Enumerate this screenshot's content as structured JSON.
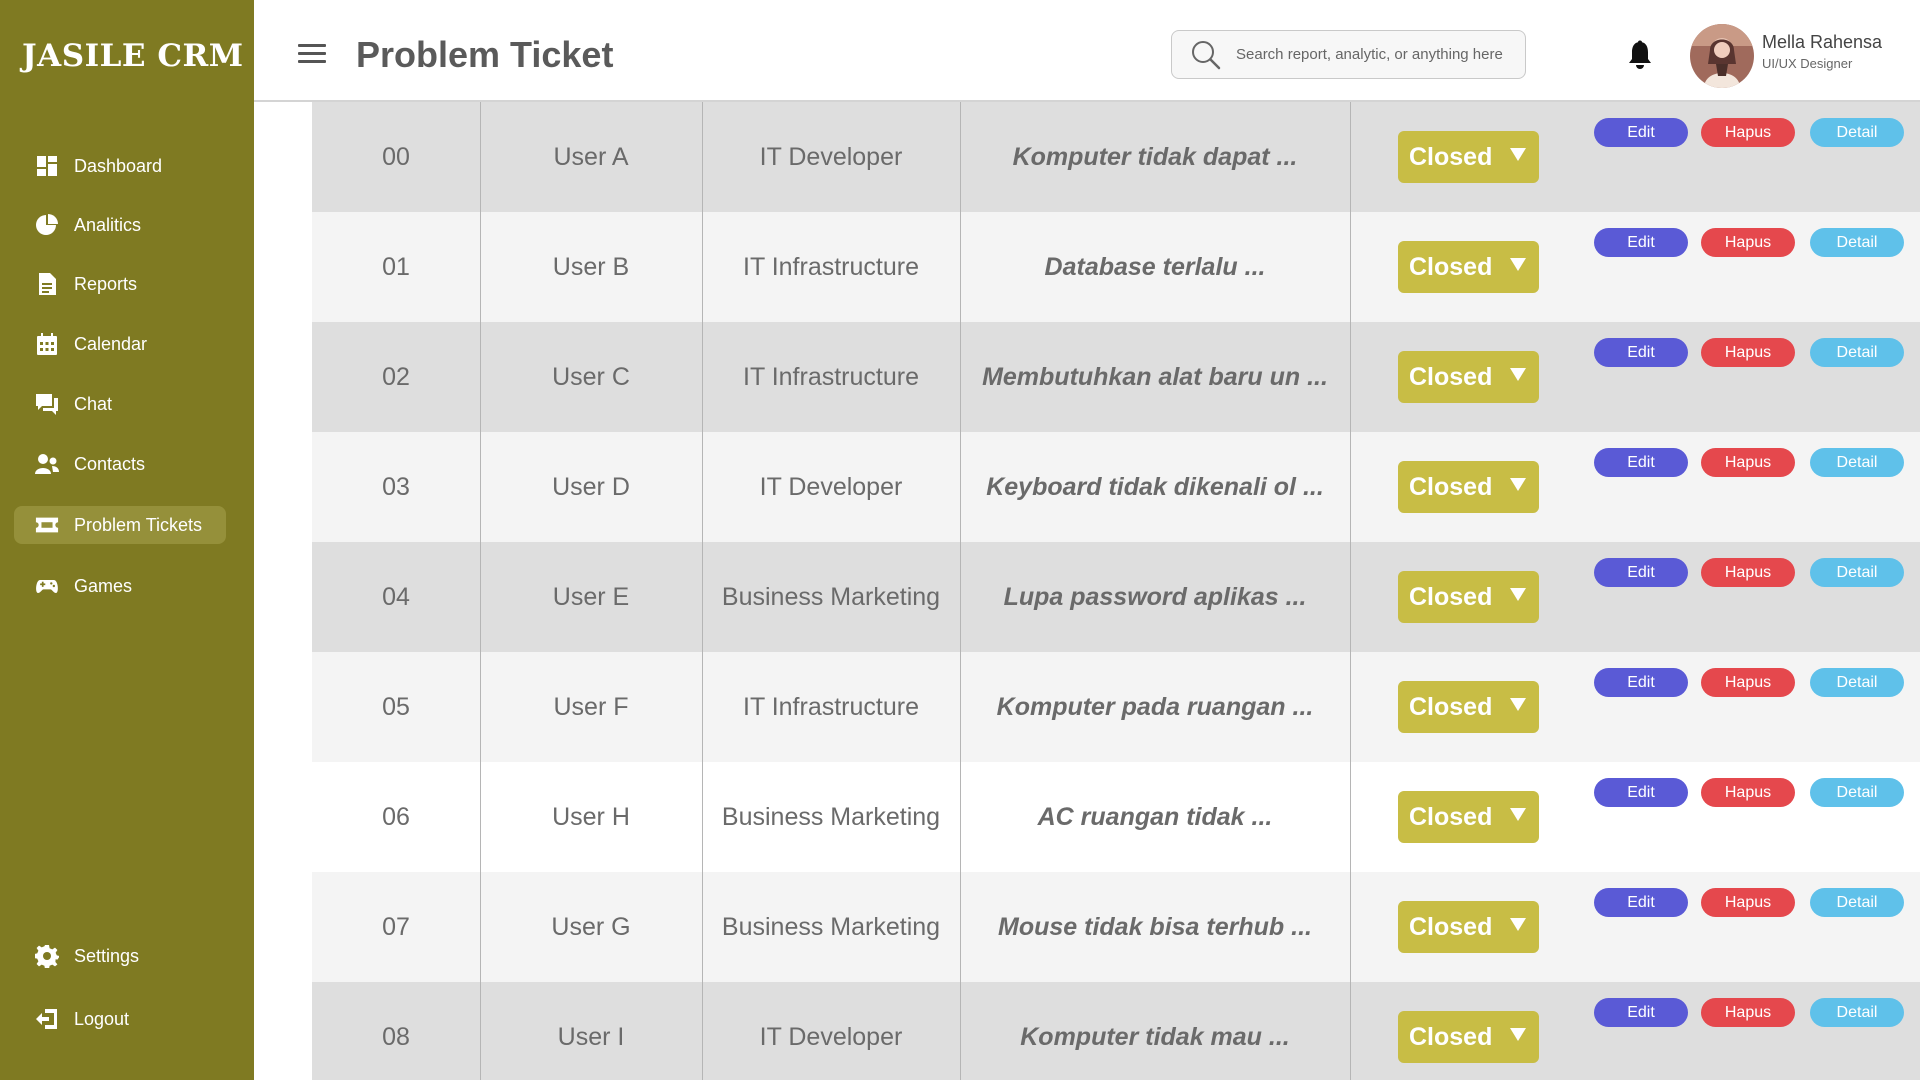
{
  "brand": "JASILE CRM",
  "sidebar": {
    "items": [
      {
        "label": "Dashboard",
        "icon": "dashboard-icon"
      },
      {
        "label": "Analitics",
        "icon": "pie-chart-icon"
      },
      {
        "label": "Reports",
        "icon": "document-icon"
      },
      {
        "label": "Calendar",
        "icon": "calendar-icon"
      },
      {
        "label": "Chat",
        "icon": "chat-icon"
      },
      {
        "label": "Contacts",
        "icon": "contacts-icon"
      },
      {
        "label": "Problem Tickets",
        "icon": "ticket-icon",
        "active": true
      },
      {
        "label": "Games",
        "icon": "gamepad-icon"
      }
    ],
    "bottom": [
      {
        "label": "Settings",
        "icon": "gear-icon"
      },
      {
        "label": "Logout",
        "icon": "logout-icon"
      }
    ]
  },
  "header": {
    "title": "Problem Ticket",
    "search_placeholder": "Search report, analytic, or anything here",
    "user_name": "Mella Rahensa",
    "user_role": "UI/UX Designer"
  },
  "colors": {
    "sidebar": "#7f7a22",
    "status": "#c8bd45",
    "edit": "#5a5ad6",
    "hapus": "#e5484d",
    "detail": "#5fc1ea"
  },
  "actions": {
    "edit": "Edit",
    "hapus": "Hapus",
    "detail": "Detail"
  },
  "tickets": [
    {
      "no": "00",
      "user": "User A",
      "dept": "IT Developer",
      "desc": "Komputer tidak dapat ...",
      "status": "Closed"
    },
    {
      "no": "01",
      "user": "User B",
      "dept": "IT Infrastructure",
      "desc": "Database terlalu ...",
      "status": "Closed"
    },
    {
      "no": "02",
      "user": "User C",
      "dept": "IT Infrastructure",
      "desc": "Membutuhkan alat baru un ...",
      "status": "Closed"
    },
    {
      "no": "03",
      "user": "User D",
      "dept": "IT Developer",
      "desc": "Keyboard tidak dikenali ol ...",
      "status": "Closed"
    },
    {
      "no": "04",
      "user": "User E",
      "dept": "Business Marketing",
      "desc": "Lupa password aplikas ...",
      "status": "Closed"
    },
    {
      "no": "05",
      "user": "User F",
      "dept": "IT Infrastructure",
      "desc": "Komputer pada ruangan ...",
      "status": "Closed"
    },
    {
      "no": "06",
      "user": "User H",
      "dept": "Business Marketing",
      "desc": "AC ruangan tidak ...",
      "status": "Closed"
    },
    {
      "no": "07",
      "user": "User G",
      "dept": "Business Marketing",
      "desc": "Mouse tidak bisa terhub ...",
      "status": "Closed"
    },
    {
      "no": "08",
      "user": "User I",
      "dept": "IT Developer",
      "desc": "Komputer tidak mau ...",
      "status": "Closed"
    }
  ]
}
